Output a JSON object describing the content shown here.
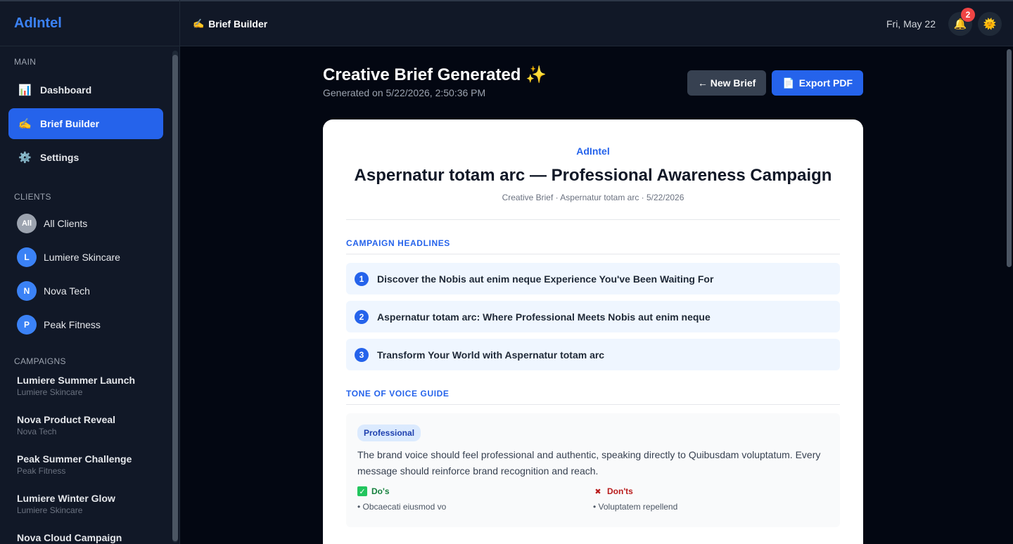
{
  "app": {
    "logo": "AdIntel"
  },
  "sidebar": {
    "main_label": "MAIN",
    "nav": [
      {
        "icon": "📊",
        "label": "Dashboard"
      },
      {
        "icon": "✍️",
        "label": "Brief Builder"
      },
      {
        "icon": "⚙️",
        "label": "Settings"
      }
    ],
    "clients_label": "CLIENTS",
    "clients": [
      {
        "initial": "All",
        "name": "All Clients"
      },
      {
        "initial": "L",
        "name": "Lumiere Skincare"
      },
      {
        "initial": "N",
        "name": "Nova Tech"
      },
      {
        "initial": "P",
        "name": "Peak Fitness"
      }
    ],
    "campaigns_label": "CAMPAIGNS",
    "campaigns": [
      {
        "name": "Lumiere Summer Launch",
        "client": "Lumiere Skincare"
      },
      {
        "name": "Nova Product Reveal",
        "client": "Nova Tech"
      },
      {
        "name": "Peak Summer Challenge",
        "client": "Peak Fitness"
      },
      {
        "name": "Lumiere Winter Glow",
        "client": "Lumiere Skincare"
      },
      {
        "name": "Nova Cloud Campaign",
        "client": ""
      }
    ]
  },
  "header": {
    "icon": "✍️",
    "title": "Brief Builder",
    "date": "Fri, May 22",
    "notification_count": "2",
    "bell_icon": "🔔",
    "theme_icon": "🌞"
  },
  "page": {
    "title": "Creative Brief Generated ✨",
    "generated": "Generated on 5/22/2026, 2:50:36 PM",
    "new_brief": "← New Brief",
    "export_icon": "📄",
    "export_label": "Export PDF"
  },
  "brief": {
    "brand": "AdIntel",
    "title": "Aspernatur totam arc — Professional Awareness Campaign",
    "meta": "Creative Brief · Aspernatur totam arc · 5/22/2026",
    "headlines_heading": "CAMPAIGN HEADLINES",
    "headlines": [
      {
        "num": "1",
        "text": "Discover the Nobis aut enim neque Experience You've Been Waiting For"
      },
      {
        "num": "2",
        "text": "Aspernatur totam arc: Where Professional Meets Nobis aut enim neque"
      },
      {
        "num": "3",
        "text": "Transform Your World with Aspernatur totam arc"
      }
    ],
    "tone_heading": "TONE OF VOICE GUIDE",
    "tone_tag": "Professional",
    "tone_description": "The brand voice should feel professional and authentic, speaking directly to Quibusdam voluptatum. Every message should reinforce brand recognition and reach.",
    "dos_label": "Do's",
    "dos_icon": "✓",
    "dos": [
      "• Obcaecati eiusmod vo"
    ],
    "donts_label": "Don'ts",
    "donts_icon": "✖",
    "donts": [
      "• Voluptatem repellend"
    ]
  }
}
